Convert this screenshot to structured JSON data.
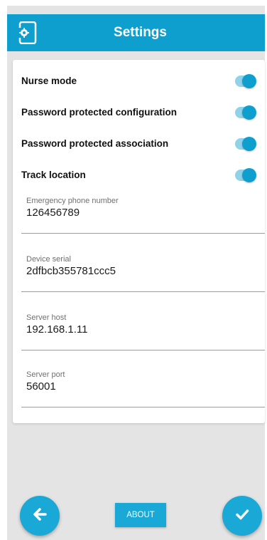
{
  "header": {
    "title": "Settings",
    "icon": "device-settings-icon"
  },
  "toggles": [
    {
      "label": "Nurse mode",
      "on": true
    },
    {
      "label": "Password protected configuration",
      "on": true
    },
    {
      "label": "Password protected association",
      "on": true
    },
    {
      "label": "Track location",
      "on": true
    }
  ],
  "fields": [
    {
      "label": "Emergency phone number",
      "value": "126456789"
    },
    {
      "label": "Device serial",
      "value": "2dfbcb355781ccc5"
    },
    {
      "label": "Server host",
      "value": "192.168.1.11"
    },
    {
      "label": "Server port",
      "value": "56001"
    }
  ],
  "footer": {
    "about_label": "ABOUT",
    "back_icon": "arrow-left-icon",
    "confirm_icon": "check-icon"
  },
  "colors": {
    "accent": "#0f9fcf",
    "accent_light": "#8fd3ea",
    "background": "#e4e4e4"
  }
}
